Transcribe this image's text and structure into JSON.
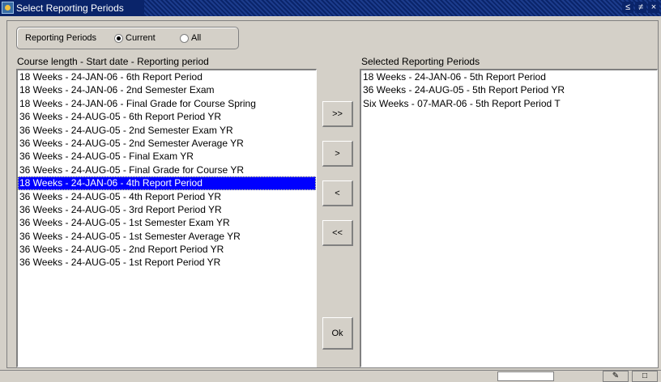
{
  "window": {
    "title": "Select Reporting Periods",
    "controls": [
      "≤",
      "≠",
      "×"
    ]
  },
  "reporting_periods": {
    "label": "Reporting Periods",
    "options": [
      {
        "label": "Current",
        "selected": true
      },
      {
        "label": "All",
        "selected": false
      }
    ]
  },
  "available": {
    "heading": "Course length  - Start date - Reporting period",
    "items": [
      "18 Weeks - 24-JAN-06 - 6th Report Period",
      "18 Weeks - 24-JAN-06 - 2nd Semester Exam",
      "18 Weeks - 24-JAN-06 - Final Grade for Course Spring",
      "36 Weeks - 24-AUG-05 - 6th Report Period YR",
      "36 Weeks - 24-AUG-05 - 2nd Semester Exam YR",
      "36 Weeks - 24-AUG-05 - 2nd Semester Average YR",
      "36 Weeks - 24-AUG-05 - Final Exam YR",
      "36 Weeks - 24-AUG-05 - Final Grade for Course YR",
      "18 Weeks - 24-JAN-06 - 4th Report Period",
      "36 Weeks - 24-AUG-05 - 4th Report Period YR",
      "36 Weeks - 24-AUG-05 - 3rd Report Period YR",
      "36 Weeks - 24-AUG-05 - 1st Semester Exam YR",
      "36 Weeks - 24-AUG-05 - 1st Semester Average YR",
      "36 Weeks - 24-AUG-05 - 2nd Report Period YR",
      "36 Weeks - 24-AUG-05 - 1st Report Period YR"
    ],
    "selected_index": 8
  },
  "selected": {
    "heading": "Selected Reporting Periods",
    "items": [
      "18 Weeks - 24-JAN-06 - 5th Report Period",
      "36 Weeks - 24-AUG-05 - 5th Report Period YR",
      "Six Weeks - 07-MAR-06 - 5th Report Period T"
    ]
  },
  "buttons": {
    "add_all": ">>",
    "add": ">",
    "remove": "<",
    "remove_all": "<<",
    "ok": "Ok"
  },
  "colors": {
    "selection": "#0000ff",
    "titlebar": "#0a246a",
    "face": "#d4d0c8"
  }
}
